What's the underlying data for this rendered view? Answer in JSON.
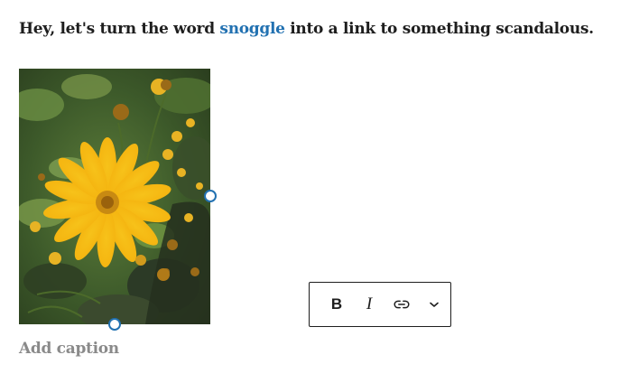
{
  "paragraph": {
    "before": "Hey, let's turn the word ",
    "link": "snoggle",
    "after": " into a link to something scandalous."
  },
  "image": {
    "caption_placeholder": "Add caption"
  },
  "toolbar": {
    "bold_label": "B",
    "italic_label": "I",
    "link_icon": "link-icon",
    "more_icon": "chevron-down-icon"
  },
  "colors": {
    "link": "#2271b1",
    "handle": "#2271b1",
    "placeholder": "#8a8a8a"
  }
}
